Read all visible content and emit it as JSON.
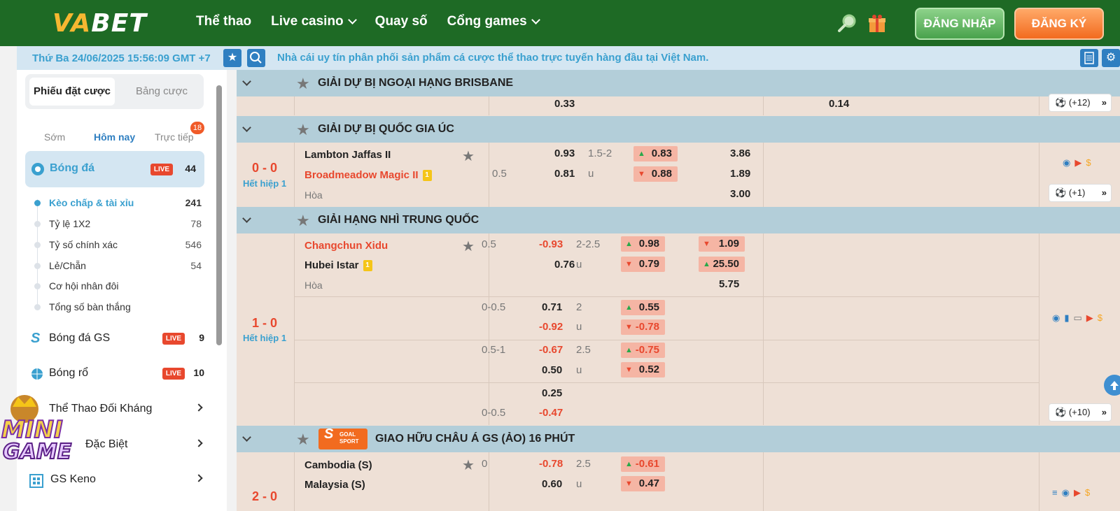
{
  "header": {
    "logo_va": "VA",
    "logo_bet": "BET",
    "nav": [
      "Thể thao",
      "Live casino",
      "Quay số",
      "Cổng games"
    ],
    "login": "ĐĂNG NHẬP",
    "register": "ĐĂNG KÝ"
  },
  "infobar": {
    "datetime": "Thứ Ba 24/06/2025 15:56:09 GMT +7",
    "marquee": "Nhà cái uy tín phân phối sản phẩm cá cược thể thao trực tuyến hàng đầu tại Việt Nam."
  },
  "sidebar": {
    "tabs": [
      "Phiếu đặt cược",
      "Bảng cược"
    ],
    "time_tabs": [
      "Sớm",
      "Hôm nay",
      "Trực tiếp"
    ],
    "live_count": "18",
    "active_sport": {
      "name": "Bóng đá",
      "live": "LIVE",
      "count": "44"
    },
    "sub": [
      {
        "label": "Kèo chấp & tài xỉu",
        "count": "241"
      },
      {
        "label": "Tỷ lệ 1X2",
        "count": "78"
      },
      {
        "label": "Tỷ số chính xác",
        "count": "546"
      },
      {
        "label": "Lẻ/Chẵn",
        "count": "54"
      },
      {
        "label": "Cơ hội nhân đôi",
        "count": ""
      },
      {
        "label": "Tổng số bàn thắng",
        "count": ""
      }
    ],
    "sports": [
      {
        "name": "Bóng đá GS",
        "live": "LIVE",
        "count": "9"
      },
      {
        "name": "Bóng rổ",
        "live": "LIVE",
        "count": "10"
      },
      {
        "name": "Thể Thao Đối Kháng"
      },
      {
        "name": "Đặc Biệt"
      },
      {
        "name": "GS Keno"
      }
    ]
  },
  "main": {
    "l1": {
      "name": "GIẢI DỰ BỊ NGOẠI HẠNG BRISBANE",
      "r_a": "0.33",
      "r_b": "0.14",
      "more": "(+12)"
    },
    "l2": {
      "name": "GIẢI DỰ BỊ QUỐC GIA ÚC",
      "score": "0 - 0",
      "half": "Hết hiệp 1",
      "home": "Lambton Jaffas II",
      "away": "Broadmeadow Magic II",
      "card": "1",
      "draw": "Hòa",
      "hdp": "0.5",
      "o1": "0.93",
      "o2": "0.81",
      "ou": "1.5-2",
      "u": "u",
      "b1": "0.83",
      "b2": "0.88",
      "x1": "3.86",
      "x2": "1.89",
      "x3": "3.00",
      "more": "(+1)"
    },
    "l3": {
      "name": "GIẢI HẠNG NHÌ TRUNG QUỐC",
      "score": "1 - 0",
      "half": "Hết hiệp 1",
      "home": "Changchun Xidu",
      "away": "Hubei Istar",
      "card": "1",
      "draw": "Hòa",
      "r1": {
        "hdp": "0.5",
        "o1": "-0.93",
        "o2": "0.76",
        "ou": "2-2.5",
        "u": "u",
        "b1": "0.98",
        "b2": "0.79",
        "c1": "1.09",
        "c2": "25.50",
        "c3": "5.75"
      },
      "r2": {
        "hdp": "0-0.5",
        "o1": "0.71",
        "o2": "-0.92",
        "ou": "2",
        "u": "u",
        "b1": "0.55",
        "b2": "-0.78"
      },
      "r3": {
        "hdp": "0.5-1",
        "o1": "-0.67",
        "o2": "0.50",
        "ou": "2.5",
        "u": "u",
        "b1": "-0.75",
        "b2": "0.52"
      },
      "r4": {
        "hdp": "0-0.5",
        "o1": "0.25",
        "o2": "-0.47"
      },
      "more": "(+10)"
    },
    "l4": {
      "name": "GIAO HỮU CHÂU Á GS (ẢO) 16 PHÚT",
      "brand": "GOAL SPORT",
      "score": "2 - 0",
      "home": "Cambodia (S)",
      "away": "Malaysia (S)",
      "hdp": "0",
      "o1": "-0.78",
      "o2": "0.60",
      "ou": "2.5",
      "u": "u",
      "b1": "-0.61",
      "b2": "0.47"
    }
  },
  "minigame": {
    "line1": "MINI",
    "line2": "GAME"
  },
  "colors": {
    "topbar": "#1e6a25",
    "accent_orange": "#f26b1f",
    "info_blue": "#3aa0cf",
    "odds_red": "#e8482e",
    "league_bg": "#b3ced9",
    "row_bg": "#eee0d6"
  }
}
